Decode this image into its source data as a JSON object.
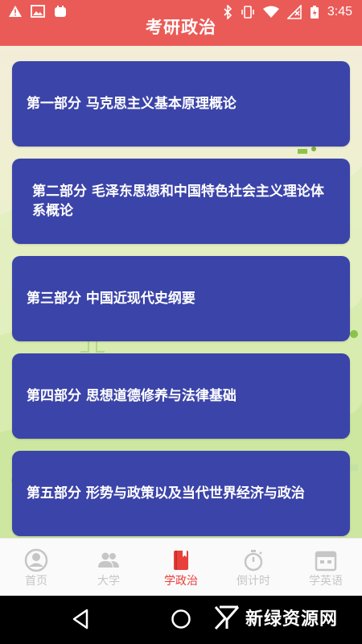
{
  "status_bar": {
    "time": "3:45",
    "icons_left": [
      "warning-icon",
      "image-icon",
      "app-icon"
    ],
    "icons_right": [
      "bluetooth-icon",
      "vibrate-icon",
      "wifi-icon",
      "no-signal-icon",
      "battery-icon"
    ]
  },
  "header": {
    "title": "考研政治"
  },
  "cards": [
    {
      "label": "第一部分 马克思主义基本原理概论"
    },
    {
      "label": "第二部分 毛泽东思想和中国特色社会主义理论体系概论"
    },
    {
      "label": "第三部分 中国近现代史纲要"
    },
    {
      "label": "第四部分 思想道德修养与法律基础"
    },
    {
      "label": "第五部分 形势与政策以及当代世界经济与政治"
    }
  ],
  "bottom_nav": {
    "items": [
      {
        "label": "首页",
        "icon": "person-icon",
        "active": false
      },
      {
        "label": "大学",
        "icon": "group-icon",
        "active": false
      },
      {
        "label": "学政治",
        "icon": "book-icon",
        "active": true
      },
      {
        "label": "倒计时",
        "icon": "stopwatch-icon",
        "active": false
      },
      {
        "label": "学英语",
        "icon": "calendar-icon",
        "active": false
      }
    ]
  },
  "colors": {
    "header": "#ea5b57",
    "card": "#3b44a8",
    "active": "#e8403b",
    "inactive": "#c6c6c6"
  },
  "watermark": {
    "text": "新绿资源网"
  }
}
